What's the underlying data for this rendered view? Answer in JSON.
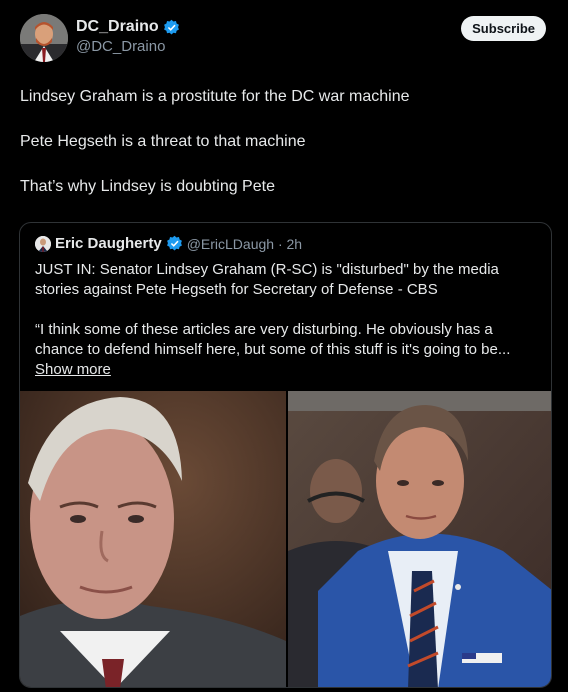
{
  "author": {
    "display_name": "DC_Draino",
    "handle": "@DC_Draino",
    "verified": true,
    "avatar_icon": "profile-photo"
  },
  "subscribe_label": "Subscribe",
  "tweet": {
    "paragraphs": [
      "Lindsey Graham is a prostitute for the DC war machine",
      "Pete Hegseth is a threat to that machine",
      "That’s why Lindsey is doubting Pete"
    ]
  },
  "quote": {
    "display_name": "Eric Daugherty",
    "handle_time": "@EricLDaugh · 2h",
    "paragraph1": "JUST IN: Senator Lindsey Graham (R-SC) is \"disturbed\" by the media stories against Pete Hegseth for Secretary of Defense - CBS",
    "paragraph2_text": "“I think some of these articles are very disturbing. He obviously has a chance to defend himself here, but some of this stuff is it's going to be... ",
    "show_more": "Show more"
  },
  "colors": {
    "background": "#000000",
    "text": "#e7e9ea",
    "secondary_text": "#8b98a5",
    "verified_blue": "#1d9bf0",
    "border": "#2f3336"
  }
}
